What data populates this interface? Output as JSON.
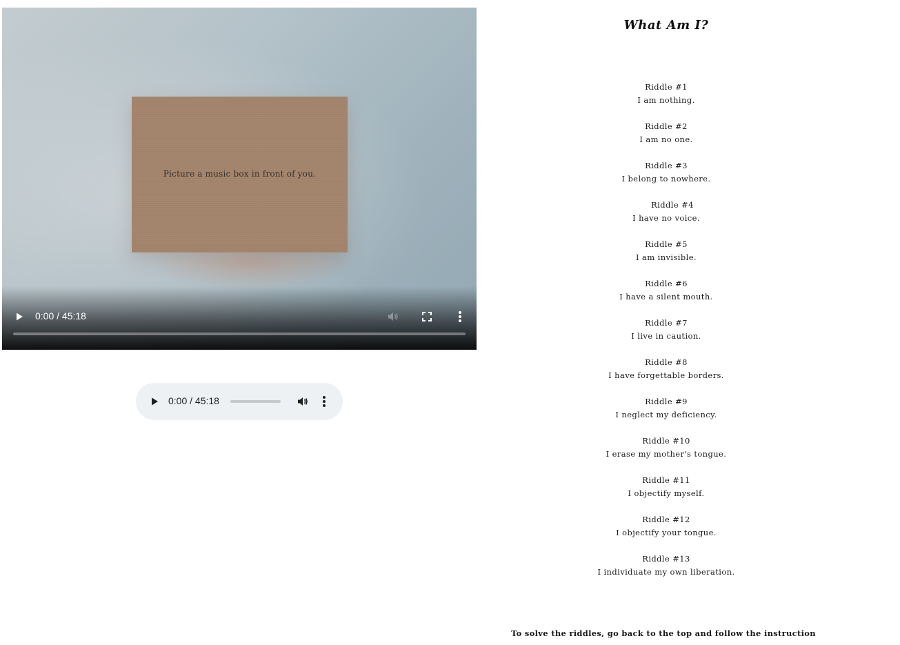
{
  "video": {
    "card_text": "Picture a music box in front of you.",
    "time": "0:00 / 45:18",
    "progress": 0,
    "icons": {
      "play": "play-icon",
      "mute": "volume-muted-icon",
      "fullscreen": "fullscreen-icon",
      "more": "more-vertical-icon"
    }
  },
  "audio": {
    "time": "0:00 / 45:18",
    "progress": 0,
    "icons": {
      "play": "play-icon",
      "volume": "volume-icon",
      "more": "more-vertical-icon"
    }
  },
  "riddles": {
    "title": "What Am I?",
    "items": [
      {
        "label": "Riddle #1",
        "text": "I am nothing."
      },
      {
        "label": "Riddle #2",
        "text": "I am no one."
      },
      {
        "label": "Riddle #3",
        "text": "I belong to nowhere."
      },
      {
        "label": "Riddle #4",
        "text": "I have no voice."
      },
      {
        "label": "Riddle #5",
        "text": "I am invisible."
      },
      {
        "label": "Riddle #6",
        "text": "I have a silent mouth."
      },
      {
        "label": "Riddle #7",
        "text": "I live in caution."
      },
      {
        "label": "Riddle #8",
        "text": "I have forgettable borders."
      },
      {
        "label": "Riddle #9",
        "text": "I neglect my deficiency."
      },
      {
        "label": "Riddle #10",
        "text": "I erase my mother's tongue."
      },
      {
        "label": "Riddle #11",
        "text": "I objectify myself."
      },
      {
        "label": "Riddle #12",
        "text": "I objectify your tongue."
      },
      {
        "label": "Riddle #13",
        "text": "I individuate my own liberation."
      }
    ],
    "footer": "To solve the riddles, go back to the top and follow the instruction"
  }
}
